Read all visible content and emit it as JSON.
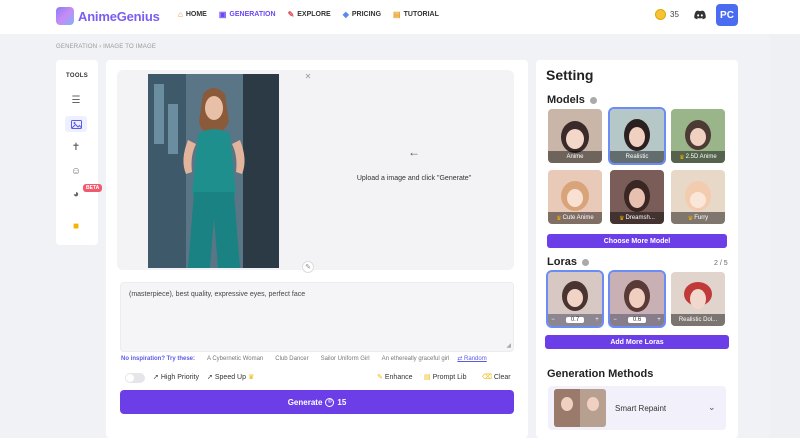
{
  "brand": {
    "name": "AnimeGenius"
  },
  "nav": {
    "items": [
      {
        "label": "HOME",
        "icon": "home-icon"
      },
      {
        "label": "GENERATION",
        "icon": "generation-icon",
        "active": true
      },
      {
        "label": "EXPLORE",
        "icon": "explore-icon"
      },
      {
        "label": "PRICING",
        "icon": "pricing-icon"
      },
      {
        "label": "TUTORIAL",
        "icon": "tutorial-icon"
      }
    ],
    "coins": "35",
    "avatar": "PC"
  },
  "breadcrumb": "GENERATION  ›  IMAGE TO IMAGE",
  "tools": {
    "title": "TOOLS",
    "beta": "BETA"
  },
  "upload": {
    "hint": "Upload a image and click \"Generate\""
  },
  "prompt": {
    "value": "(masterpiece), best quality, expressive eyes, perfect face"
  },
  "inspiration": {
    "label": "No inspiration? Try these:",
    "chips": [
      "A Cybernetic Woman",
      "Club Dancer",
      "Sailor Uniform Girl",
      "An ethereally graceful girl"
    ],
    "random": "Random"
  },
  "options": {
    "high_priority": "High Priority",
    "speed_up": "Speed Up",
    "enhance": "Enhance",
    "prompt_lib": "Prompt Lib",
    "clear": "Clear"
  },
  "generate": {
    "label": "Generate",
    "cost": "15"
  },
  "settings": {
    "title": "Setting",
    "models_title": "Models",
    "models": [
      {
        "label": "Anime",
        "premium": false,
        "selected": false
      },
      {
        "label": "Realistic",
        "premium": false,
        "selected": true
      },
      {
        "label": "2.5D Anime",
        "premium": true,
        "selected": false
      },
      {
        "label": "Cute Anime",
        "premium": true,
        "selected": false
      },
      {
        "label": "Dreamsh...",
        "premium": true,
        "selected": false
      },
      {
        "label": "Furry",
        "premium": true,
        "selected": false
      }
    ],
    "choose_more_model": "Choose More Model",
    "loras_title": "Loras",
    "loras_count": "2 / 5",
    "loras": [
      {
        "label": "",
        "value": "0.7",
        "selected": true
      },
      {
        "label": "",
        "value": "0.6",
        "selected": true
      },
      {
        "label": "Realistic Dol...",
        "value": "",
        "selected": false
      }
    ],
    "add_more_loras": "Add More Loras",
    "methods_title": "Generation Methods",
    "method": "Smart Repaint"
  }
}
